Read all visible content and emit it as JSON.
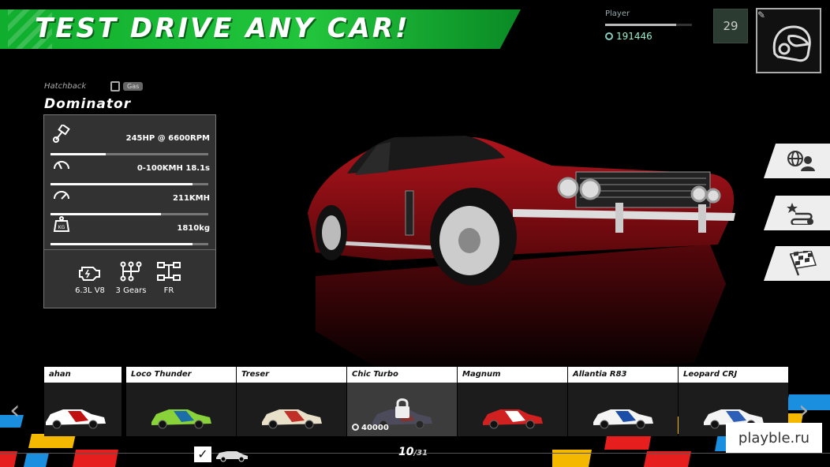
{
  "banner": {
    "title": "TEST DRIVE ANY CAR!"
  },
  "player": {
    "name": "Player",
    "coins": "191446",
    "level": "29",
    "xp_progress": 0.82
  },
  "car": {
    "class": "Hatchback",
    "fuel": "Gas",
    "name": "Dominator",
    "stats": [
      {
        "icon": "piston-icon",
        "value": "245HP @ 6600RPM",
        "fill": 0.35
      },
      {
        "icon": "speedometer-icon",
        "value": "0-100KMH 18.1s",
        "fill": 0.9
      },
      {
        "icon": "gauge-icon",
        "value": "211KMH",
        "fill": 0.7
      },
      {
        "icon": "weight-icon",
        "value": "1810kg",
        "fill": 0.9
      }
    ],
    "specs": [
      {
        "icon": "engine-icon",
        "label": "6.3L V8"
      },
      {
        "icon": "gearbox-icon",
        "label": "3 Gears"
      },
      {
        "icon": "drivetrain-icon",
        "label": "FR"
      }
    ],
    "color": "#8a0f14"
  },
  "side_menu": [
    {
      "icon": "online-multiplayer-icon"
    },
    {
      "icon": "route-star-icon"
    },
    {
      "icon": "checkered-flag-icon"
    }
  ],
  "carousel": {
    "cars": [
      {
        "name": "ahan",
        "color": "#ffffff",
        "accent": "#c01010",
        "locked": false
      },
      {
        "name": "Loco Thunder",
        "color": "#8ad23a",
        "accent": "#1c6ea8",
        "locked": false
      },
      {
        "name": "Treser",
        "color": "#e8e0c8",
        "accent": "#c03028",
        "locked": false
      },
      {
        "name": "Chic Turbo",
        "color": "#5a5a7a",
        "accent": "#c03028",
        "locked": true,
        "price": "40000"
      },
      {
        "name": "Magnum",
        "color": "#d02020",
        "accent": "#ffffff",
        "locked": false
      },
      {
        "name": "Allantia R83",
        "color": "#f4f4f4",
        "accent": "#1c4ea8",
        "locked": false
      },
      {
        "name": "Leopard CRJ",
        "color": "#f4f4f4",
        "accent": "#2e5fb8",
        "locked": false
      }
    ],
    "index": "10",
    "total": "/31",
    "prev_arrow": "‹",
    "next_arrow": "›",
    "check": "✓"
  },
  "watermark": "playble.ru"
}
